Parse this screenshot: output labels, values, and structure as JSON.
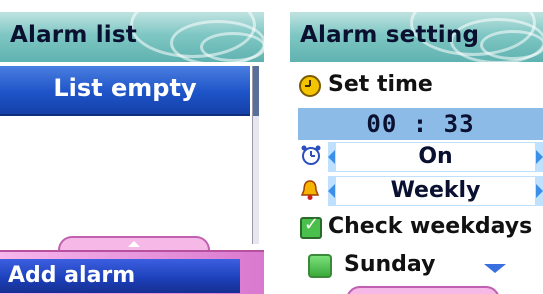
{
  "alarm_list": {
    "title": "Alarm list",
    "list_empty": "List empty",
    "add_alarm": "Add alarm"
  },
  "alarm_setting": {
    "title": "Alarm setting",
    "set_time_label": "Set time",
    "time_value": "00 : 33",
    "status_value": "On",
    "repeat_value": "Weekly",
    "check_weekdays_label": "Check weekdays",
    "day_label": "Sunday"
  },
  "colors": {
    "title_bar": "#7fc7c4",
    "selection_blue": "#1e54c8",
    "softkey_pink": "#d978cf",
    "field_blue": "#8dbbe8",
    "arrow_blue": "#3a8fe8"
  },
  "icons": [
    "clock-icon",
    "alarm-clock-icon",
    "bell-icon",
    "checkbox-icon",
    "chevron-left-icon",
    "chevron-right-icon",
    "dropdown-arrow-icon"
  ]
}
